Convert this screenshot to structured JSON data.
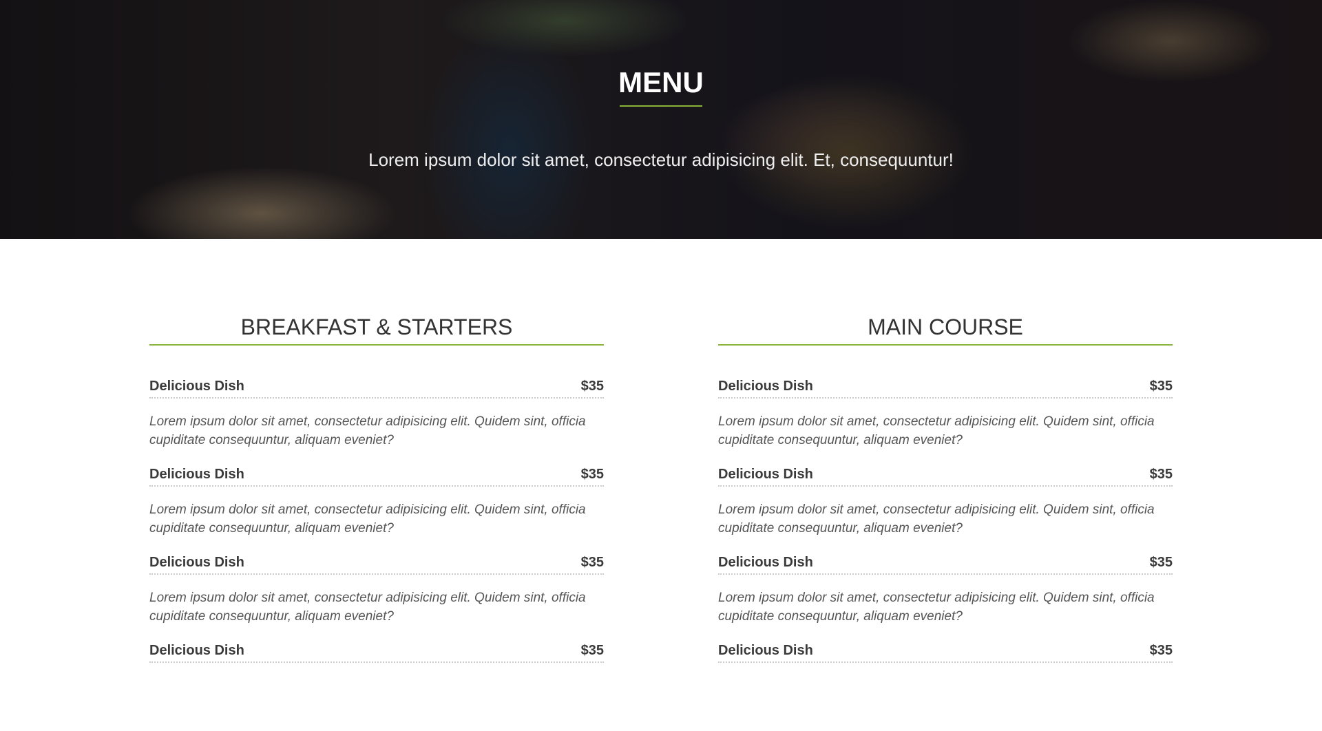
{
  "hero": {
    "title": "MENU",
    "subtitle": "Lorem ipsum dolor sit amet, consectetur adipisicing elit. Et, consequuntur!",
    "accent": "#8ab33a"
  },
  "sections": [
    {
      "title": "BREAKFAST & STARTERS",
      "items": [
        {
          "name": "Delicious Dish",
          "price": "$35",
          "desc": "Lorem ipsum dolor sit amet, consectetur adipisicing elit. Quidem sint, officia cupiditate consequuntur, aliquam eveniet?"
        },
        {
          "name": "Delicious Dish",
          "price": "$35",
          "desc": "Lorem ipsum dolor sit amet, consectetur adipisicing elit. Quidem sint, officia cupiditate consequuntur, aliquam eveniet?"
        },
        {
          "name": "Delicious Dish",
          "price": "$35",
          "desc": "Lorem ipsum dolor sit amet, consectetur adipisicing elit. Quidem sint, officia cupiditate consequuntur, aliquam eveniet?"
        },
        {
          "name": "Delicious Dish",
          "price": "$35"
        }
      ]
    },
    {
      "title": "MAIN COURSE",
      "items": [
        {
          "name": "Delicious Dish",
          "price": "$35",
          "desc": "Lorem ipsum dolor sit amet, consectetur adipisicing elit. Quidem sint, officia cupiditate consequuntur, aliquam eveniet?"
        },
        {
          "name": "Delicious Dish",
          "price": "$35",
          "desc": "Lorem ipsum dolor sit amet, consectetur adipisicing elit. Quidem sint, officia cupiditate consequuntur, aliquam eveniet?"
        },
        {
          "name": "Delicious Dish",
          "price": "$35",
          "desc": "Lorem ipsum dolor sit amet, consectetur adipisicing elit. Quidem sint, officia cupiditate consequuntur, aliquam eveniet?"
        },
        {
          "name": "Delicious Dish",
          "price": "$35"
        }
      ]
    }
  ]
}
